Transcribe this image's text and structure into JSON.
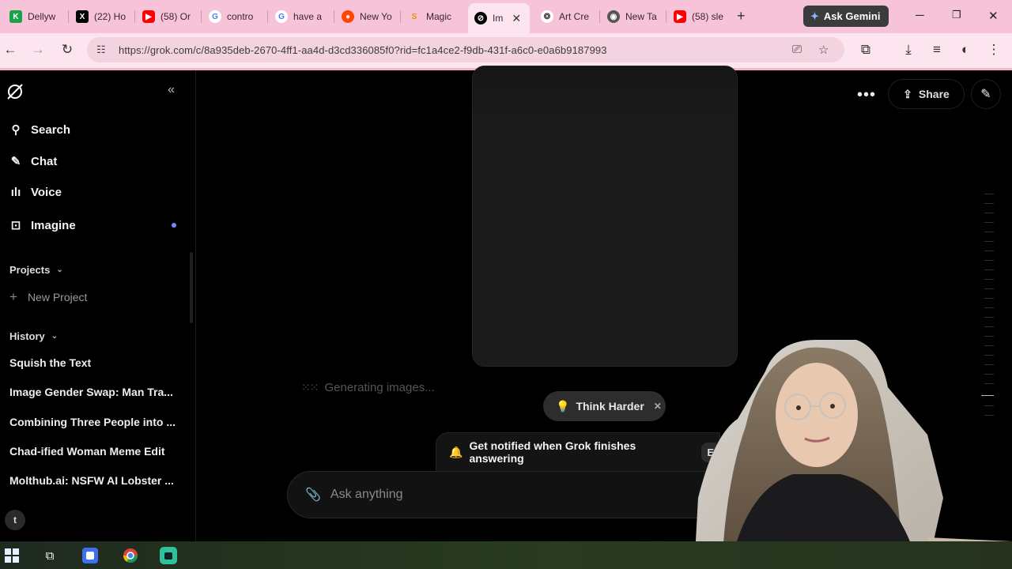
{
  "browser": {
    "tabs": [
      {
        "title": "Dellyw",
        "icon": "k-logo-icon",
        "color": "#1aa34a"
      },
      {
        "title": "(22) Ho",
        "icon": "x-logo-icon",
        "color": "#000000"
      },
      {
        "title": "(58) Or",
        "icon": "youtube-icon",
        "color": "#ff0000"
      },
      {
        "title": "contro",
        "icon": "google-icon",
        "color": "#4285f4"
      },
      {
        "title": "have a",
        "icon": "google-icon",
        "color": "#4285f4"
      },
      {
        "title": "New Yo",
        "icon": "reddit-icon",
        "color": "#ff4500"
      },
      {
        "title": "Magic",
        "icon": "magic-s-icon",
        "color": "#f0b400"
      },
      {
        "title": "Im",
        "icon": "grok-icon",
        "color": "#000000",
        "active": true
      },
      {
        "title": "Art Cre",
        "icon": "openai-icon",
        "color": "#444444"
      },
      {
        "title": "New Ta",
        "icon": "chrome-icon",
        "color": "#444444"
      },
      {
        "title": "(58) sle",
        "icon": "youtube-icon",
        "color": "#ff0000"
      }
    ],
    "ask_gemini": "Ask Gemini",
    "url": "https://grok.com/c/8a935deb-2670-4ff1-aa4d-d3cd336085f0?rid=fc1a4ce2-f9db-431f-a6c0-e0a6b9187993"
  },
  "sidebar": {
    "nav": [
      {
        "label": "Search",
        "icon": "search-icon"
      },
      {
        "label": "Chat",
        "icon": "chat-icon"
      },
      {
        "label": "Voice",
        "icon": "voice-icon"
      },
      {
        "label": "Imagine",
        "icon": "imagine-icon"
      }
    ],
    "projects_label": "Projects",
    "new_project_label": "New Project",
    "history_label": "History",
    "history": [
      "Squish the Text",
      "Image Gender Swap: Man Tra...",
      "Combining Three People into ...",
      "Chad-ified Woman Meme Edit",
      "Molthub.ai: NSFW AI Lobster ..."
    ],
    "avatar_letter": "t"
  },
  "main": {
    "share_label": "Share",
    "generating_label": "Generating images...",
    "think_harder_label": "Think Harder",
    "notify_label": "Get notified when Grok finishes answering",
    "notify_button": "E",
    "composer_placeholder": "Ask anything"
  },
  "colors": {
    "tabstrip": "#f7c3d8",
    "toolbar": "#fce5ee",
    "background": "#000000",
    "accent_dot": "#6c8cff"
  }
}
